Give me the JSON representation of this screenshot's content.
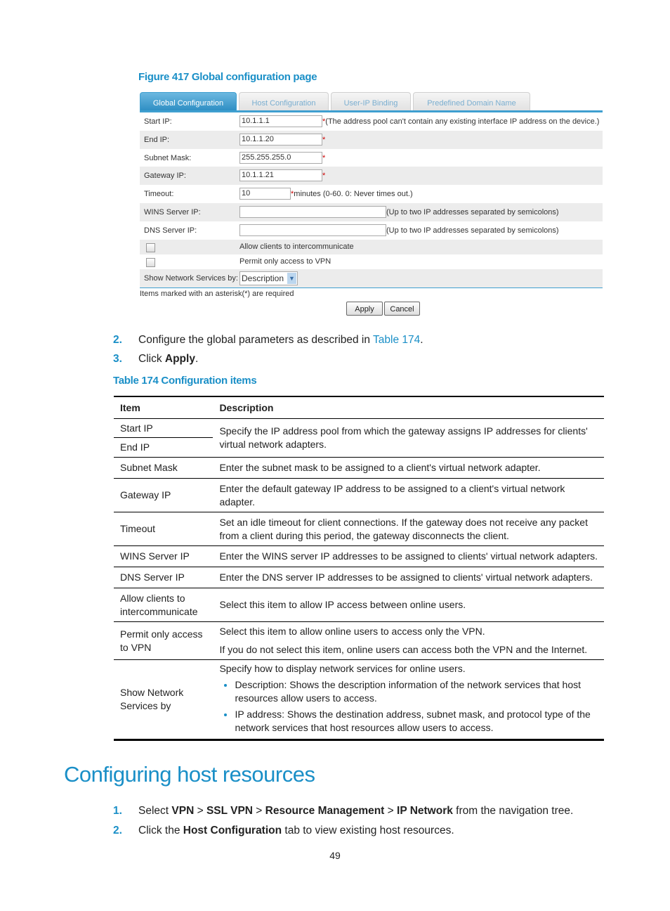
{
  "figure": {
    "caption": "Figure 417 Global configuration page",
    "tabs": [
      "Global Configuration",
      "Host Configuration",
      "User-IP Binding",
      "Predefined Domain Name"
    ],
    "fields": {
      "start_ip": {
        "label": "Start IP:",
        "value": "10.1.1.1",
        "note": "(The address pool can't contain any existing interface IP address on the device.)"
      },
      "end_ip": {
        "label": "End IP:",
        "value": "10.1.1.20"
      },
      "subnet_mask": {
        "label": "Subnet Mask:",
        "value": "255.255.255.0"
      },
      "gateway_ip": {
        "label": "Gateway IP:",
        "value": "10.1.1.21"
      },
      "timeout": {
        "label": "Timeout:",
        "value": "10",
        "note": "minutes (0-60. 0: Never times out.)"
      },
      "wins": {
        "label": "WINS Server IP:",
        "value": "",
        "note": "(Up to two IP addresses separated by semicolons)"
      },
      "dns": {
        "label": "DNS Server IP:",
        "value": "",
        "note": "(Up to two IP addresses separated by semicolons)"
      },
      "allow": {
        "label": "Allow clients to intercommunicate",
        "checked": false
      },
      "permit": {
        "label": "Permit only access to VPN",
        "checked": false
      },
      "show_by": {
        "label": "Show Network Services by:",
        "value": "Description"
      }
    },
    "asterisk": "*",
    "required_note": "Items marked with an asterisk(*) are required",
    "apply": "Apply",
    "cancel": "Cancel"
  },
  "steps1": [
    {
      "n": "2.",
      "pre": "Configure the global parameters as described in ",
      "link": "Table 174",
      "post": "."
    },
    {
      "n": "3.",
      "pre": "Click ",
      "bold": "Apply",
      "post": "."
    }
  ],
  "table": {
    "caption": "Table 174 Configuration items",
    "headers": [
      "Item",
      "Description"
    ],
    "rows": [
      {
        "item": "Start IP"
      },
      {
        "item": "End IP"
      },
      {
        "desc": "Specify the IP address pool from which the gateway assigns IP addresses for clients' virtual network adapters."
      },
      {
        "item": "Subnet Mask",
        "desc": "Enter the subnet mask to be assigned to a client's virtual network adapter."
      },
      {
        "item": "Gateway IP",
        "desc": "Enter the default gateway IP address to be assigned to a client's virtual network adapter."
      },
      {
        "item": "Timeout",
        "desc": "Set an idle timeout for client connections. If the gateway does not receive any packet from a client during this period, the gateway disconnects the client."
      },
      {
        "item": "WINS Server IP",
        "desc": "Enter the WINS server IP addresses to be assigned to clients' virtual network adapters."
      },
      {
        "item": "DNS Server IP",
        "desc": "Enter the DNS server IP addresses to be assigned to clients' virtual network adapters."
      },
      {
        "item": "Allow clients to intercommunicate",
        "desc": "Select this item to allow IP access between online users."
      },
      {
        "item": "Permit only access to VPN",
        "desc": "Select this item to allow online users to access only the VPN.",
        "desc2": "If you do not select this item, online users can access both the VPN and the Internet."
      },
      {
        "item": "Show Network Services by",
        "desc": "Specify how to display network services for online users.",
        "bullets": [
          "Description: Shows the description information of the network services that host resources allow users to access.",
          "IP address: Shows the destination address, subnet mask, and protocol type of the network services that host resources allow users to access."
        ]
      }
    ]
  },
  "section_title": "Configuring host resources",
  "steps2": [
    {
      "n": "1.",
      "t1": "Select ",
      "b1": "VPN",
      "t2": " > ",
      "b2": "SSL VPN",
      "t3": " > ",
      "b3": "Resource Management",
      "t4": " > ",
      "b4": "IP Network",
      "t5": " from the navigation tree."
    },
    {
      "n": "2.",
      "t1": "Click the ",
      "b1": "Host Configuration",
      "t2": " tab to view existing host resources."
    }
  ],
  "page_number": "49",
  "colors": {
    "accent": "#1a8fc7",
    "tab_active": "#3f9fd0"
  }
}
